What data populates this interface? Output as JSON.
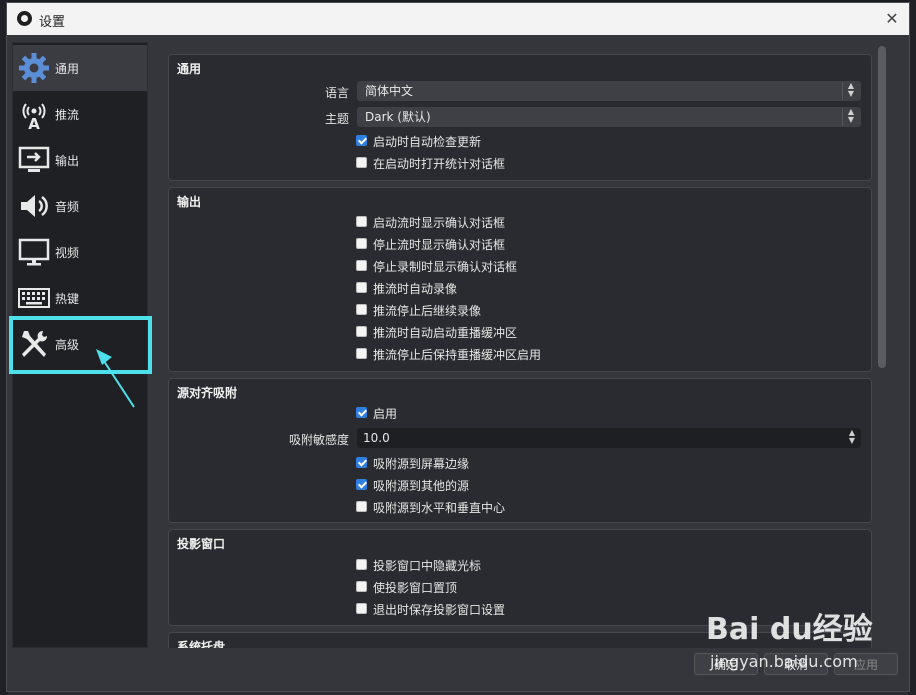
{
  "window": {
    "title": "设置"
  },
  "sidebar": {
    "items": [
      {
        "label": "通用",
        "icon": "gear-icon",
        "selected": true
      },
      {
        "label": "推流",
        "icon": "antenna-icon",
        "selected": false
      },
      {
        "label": "输出",
        "icon": "output-monitor-icon",
        "selected": false
      },
      {
        "label": "音频",
        "icon": "speaker-icon",
        "selected": false
      },
      {
        "label": "视频",
        "icon": "monitor-icon",
        "selected": false
      },
      {
        "label": "热键",
        "icon": "keyboard-icon",
        "selected": false
      },
      {
        "label": "高级",
        "icon": "tools-icon",
        "selected": false
      }
    ]
  },
  "groups": {
    "general": {
      "title": "通用",
      "language_label": "语言",
      "language_value": "简体中文",
      "theme_label": "主题",
      "theme_value": "Dark (默认)",
      "checkboxes": [
        {
          "label": "启动时自动检查更新",
          "checked": true
        },
        {
          "label": "在启动时打开统计对话框",
          "checked": false
        }
      ]
    },
    "output": {
      "title": "输出",
      "checkboxes": [
        {
          "label": "启动流时显示确认对话框",
          "checked": false
        },
        {
          "label": "停止流时显示确认对话框",
          "checked": false
        },
        {
          "label": "停止录制时显示确认对话框",
          "checked": false
        },
        {
          "label": "推流时自动录像",
          "checked": false
        },
        {
          "label": "推流停止后继续录像",
          "checked": false
        },
        {
          "label": "推流时自动启动重播缓冲区",
          "checked": false
        },
        {
          "label": "推流停止后保持重播缓冲区启用",
          "checked": false
        }
      ]
    },
    "snapping": {
      "title": "源对齐吸附",
      "enable_label": "启用",
      "enable_checked": true,
      "sensitivity_label": "吸附敏感度",
      "sensitivity_value": "10.0",
      "checkboxes": [
        {
          "label": "吸附源到屏幕边缘",
          "checked": true
        },
        {
          "label": "吸附源到其他的源",
          "checked": true
        },
        {
          "label": "吸附源到水平和垂直中心",
          "checked": false
        }
      ]
    },
    "projector": {
      "title": "投影窗口",
      "checkboxes": [
        {
          "label": "投影窗口中隐藏光标",
          "checked": false
        },
        {
          "label": "使投影窗口置顶",
          "checked": false
        },
        {
          "label": "退出时保存投影窗口设置",
          "checked": false
        }
      ]
    },
    "tray": {
      "title": "系统托盘"
    }
  },
  "footer": {
    "ok_label": "确定",
    "cancel_label": "取消",
    "apply_label": "应用"
  },
  "watermark": {
    "brand": "Bai du经验",
    "url": "jingyan.baidu.com"
  },
  "colors": {
    "accent": "#2f7fe0",
    "highlight": "#4ee0ea"
  }
}
